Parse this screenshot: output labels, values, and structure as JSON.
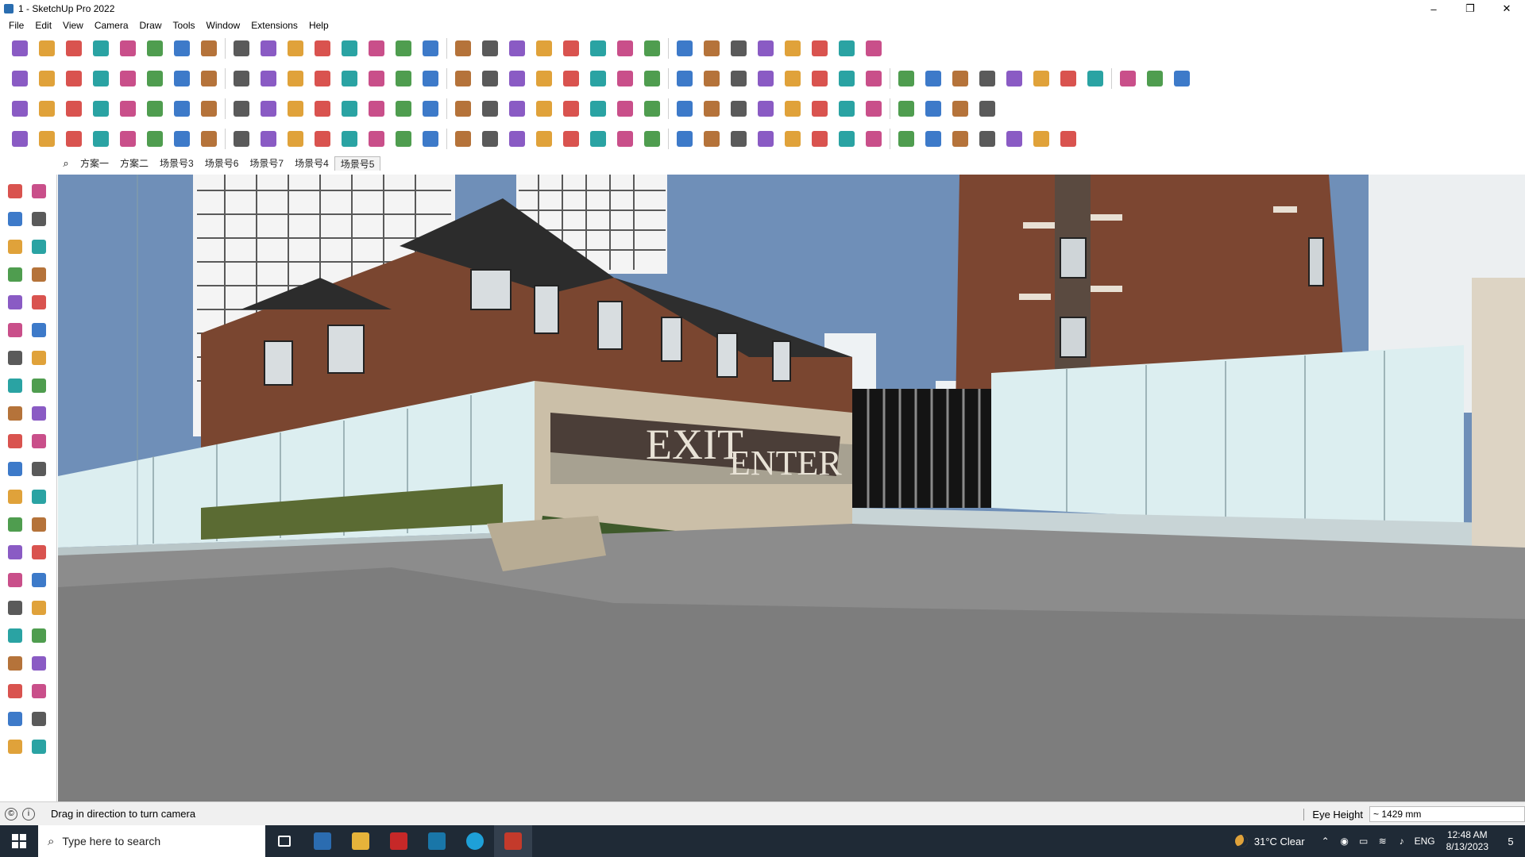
{
  "window": {
    "title": "1 - SketchUp Pro 2022",
    "controls": [
      "–",
      "❐",
      "✕"
    ]
  },
  "menu": [
    "File",
    "Edit",
    "View",
    "Camera",
    "Draw",
    "Tools",
    "Window",
    "Extensions",
    "Help"
  ],
  "scene_tabs": {
    "items": [
      "方案一",
      "方案二",
      "场景号3",
      "场景号6",
      "场景号7",
      "场景号4",
      "场景号5"
    ],
    "active": "场景号5"
  },
  "toolbars": {
    "row1": [
      "zoom-extents",
      "select",
      "eraser",
      "line",
      "arc",
      "rectangle",
      "push-pull",
      "follow-me",
      "move",
      "rotate",
      "scale",
      "tape-measure",
      "text",
      "paint",
      "orbit",
      "pan",
      "zoom",
      "zoom-window",
      "zoom-extents",
      "section-plane",
      "section-cuts",
      "section-fill",
      "user-account",
      "component",
      "material",
      "sandbox",
      "to-from",
      "smoothing",
      "fit",
      "undo",
      "redo",
      "section-display"
    ],
    "row2": [
      "iso",
      "top",
      "front",
      "right",
      "back",
      "left",
      "bottom",
      "styles",
      "xray",
      "wireframe",
      "hidden",
      "shaded",
      "texture",
      "mono",
      "groups",
      "components",
      "house",
      "garage",
      "roof",
      "home",
      "cabinet",
      "fixtures",
      "leaf",
      "pencil",
      "circle",
      "hexagon",
      "pentagon",
      "ellipse",
      "parallelogram",
      "wave",
      "spiral",
      "cone",
      "shape",
      "loop",
      "rotate3d",
      "erase",
      "brick",
      "grid",
      "stones",
      "wall",
      "cup",
      "panel",
      "wedge"
    ],
    "row3": [
      "plane",
      "prism",
      "prism2",
      "prism3",
      "slice",
      "curve",
      "rectangle",
      "panel",
      "pipe",
      "bend",
      "bend2",
      "spline",
      "add",
      "cross",
      "flip",
      "fill",
      "fill2",
      "triangle",
      "lasso",
      "select2",
      "move2",
      "puzzle",
      "bucket",
      "undo2",
      "clip",
      "wrap",
      "stack",
      "stack2",
      "tag",
      "chain",
      "grid2",
      "grid3",
      "grid4",
      "arrows",
      "dashed",
      "tiles"
    ],
    "row4": [
      "profile",
      "path",
      "road",
      "scissor",
      "gear",
      "draft",
      "twist",
      "brain",
      "dome",
      "sweep",
      "stair",
      "corner",
      "angle",
      "line2",
      "curve2",
      "cable",
      "triangle2",
      "ruler",
      "sphere",
      "hand",
      "leaf2",
      "arrow",
      "layers",
      "slope",
      "wedge2",
      "fan",
      "lattice",
      "chair",
      "curve3",
      "comb",
      "mesh",
      "grid5",
      "bars",
      "twist2",
      "tube",
      "shell",
      "fin",
      "net",
      "multi"
    ]
  },
  "left_toolbar": [
    "select",
    "orbit",
    "paint",
    "eraser",
    "component",
    "tape",
    "pencil",
    "freehand",
    "rectangle",
    "rotated-rect",
    "circle",
    "polygon",
    "arc",
    "arc3",
    "pie",
    "arc2",
    "move",
    "push-pull",
    "rotate",
    "follow-me",
    "scale",
    "offset",
    "tape-measure",
    "dimension",
    "protractor",
    "text",
    "axes",
    "3d-text",
    "orbit",
    "pan",
    "zoom",
    "zoom-window",
    "zoom-extents",
    "previous",
    "position-camera",
    "look-around",
    "walk",
    "position",
    "section-plane",
    "section-display",
    "section-cuts",
    "section-fill"
  ],
  "viewport": {
    "sign_exit": "EXIT",
    "sign_enter": "ENTER"
  },
  "status": {
    "hint": "Drag in direction to turn camera",
    "measure_label": "Eye Height",
    "measure_value": "~ 1429 mm"
  },
  "taskbar": {
    "search_placeholder": "Type here to search",
    "apps": [
      "task-view",
      "calculator",
      "explorer",
      "autocad",
      "sketchup-app",
      "edge",
      "sketchup"
    ],
    "weather": "31°C  Clear",
    "lang": "ENG",
    "time": "12:48 AM",
    "date": "8/13/2023",
    "notifications": "5"
  },
  "colors": {
    "sky": "#6f8fb8",
    "brick": "#7a4630",
    "stone": "#cbbfa8",
    "glass_wall": "#dceef0",
    "road": "#8c8c8c",
    "taskbar": "#1f2a36"
  }
}
